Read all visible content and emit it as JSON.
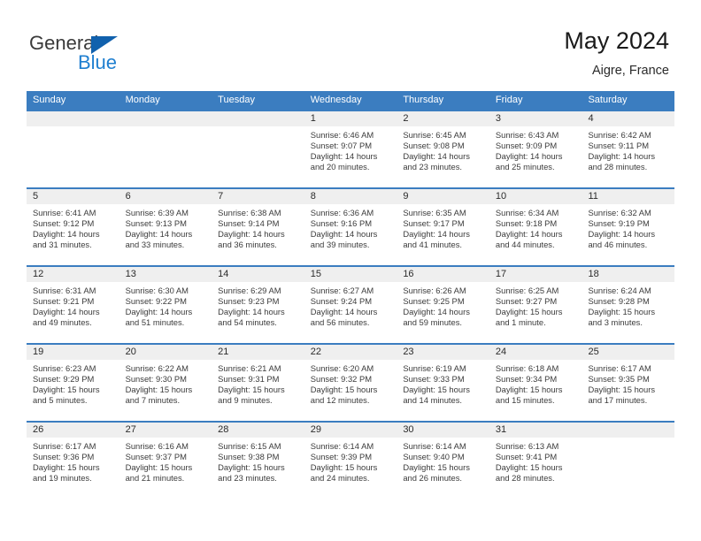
{
  "brand": {
    "name_part1": "General",
    "name_part2": "Blue",
    "triangle_color": "#1161ad",
    "blue_color": "#1f7fd0"
  },
  "header": {
    "title": "May 2024",
    "subtitle": "Aigre, France"
  },
  "theme": {
    "header_blue": "#3b7dc0",
    "day_number_band": "#efefef",
    "cell_background": "#ffffff",
    "text_color": "#3b3b3b"
  },
  "weekdays": [
    "Sunday",
    "Monday",
    "Tuesday",
    "Wednesday",
    "Thursday",
    "Friday",
    "Saturday"
  ],
  "weeks": [
    [
      {
        "day": "",
        "sunrise": "",
        "sunset": "",
        "daylight_line1": "",
        "daylight_line2": ""
      },
      {
        "day": "",
        "sunrise": "",
        "sunset": "",
        "daylight_line1": "",
        "daylight_line2": ""
      },
      {
        "day": "",
        "sunrise": "",
        "sunset": "",
        "daylight_line1": "",
        "daylight_line2": ""
      },
      {
        "day": "1",
        "sunrise": "Sunrise: 6:46 AM",
        "sunset": "Sunset: 9:07 PM",
        "daylight_line1": "Daylight: 14 hours",
        "daylight_line2": "and 20 minutes."
      },
      {
        "day": "2",
        "sunrise": "Sunrise: 6:45 AM",
        "sunset": "Sunset: 9:08 PM",
        "daylight_line1": "Daylight: 14 hours",
        "daylight_line2": "and 23 minutes."
      },
      {
        "day": "3",
        "sunrise": "Sunrise: 6:43 AM",
        "sunset": "Sunset: 9:09 PM",
        "daylight_line1": "Daylight: 14 hours",
        "daylight_line2": "and 25 minutes."
      },
      {
        "day": "4",
        "sunrise": "Sunrise: 6:42 AM",
        "sunset": "Sunset: 9:11 PM",
        "daylight_line1": "Daylight: 14 hours",
        "daylight_line2": "and 28 minutes."
      }
    ],
    [
      {
        "day": "5",
        "sunrise": "Sunrise: 6:41 AM",
        "sunset": "Sunset: 9:12 PM",
        "daylight_line1": "Daylight: 14 hours",
        "daylight_line2": "and 31 minutes."
      },
      {
        "day": "6",
        "sunrise": "Sunrise: 6:39 AM",
        "sunset": "Sunset: 9:13 PM",
        "daylight_line1": "Daylight: 14 hours",
        "daylight_line2": "and 33 minutes."
      },
      {
        "day": "7",
        "sunrise": "Sunrise: 6:38 AM",
        "sunset": "Sunset: 9:14 PM",
        "daylight_line1": "Daylight: 14 hours",
        "daylight_line2": "and 36 minutes."
      },
      {
        "day": "8",
        "sunrise": "Sunrise: 6:36 AM",
        "sunset": "Sunset: 9:16 PM",
        "daylight_line1": "Daylight: 14 hours",
        "daylight_line2": "and 39 minutes."
      },
      {
        "day": "9",
        "sunrise": "Sunrise: 6:35 AM",
        "sunset": "Sunset: 9:17 PM",
        "daylight_line1": "Daylight: 14 hours",
        "daylight_line2": "and 41 minutes."
      },
      {
        "day": "10",
        "sunrise": "Sunrise: 6:34 AM",
        "sunset": "Sunset: 9:18 PM",
        "daylight_line1": "Daylight: 14 hours",
        "daylight_line2": "and 44 minutes."
      },
      {
        "day": "11",
        "sunrise": "Sunrise: 6:32 AM",
        "sunset": "Sunset: 9:19 PM",
        "daylight_line1": "Daylight: 14 hours",
        "daylight_line2": "and 46 minutes."
      }
    ],
    [
      {
        "day": "12",
        "sunrise": "Sunrise: 6:31 AM",
        "sunset": "Sunset: 9:21 PM",
        "daylight_line1": "Daylight: 14 hours",
        "daylight_line2": "and 49 minutes."
      },
      {
        "day": "13",
        "sunrise": "Sunrise: 6:30 AM",
        "sunset": "Sunset: 9:22 PM",
        "daylight_line1": "Daylight: 14 hours",
        "daylight_line2": "and 51 minutes."
      },
      {
        "day": "14",
        "sunrise": "Sunrise: 6:29 AM",
        "sunset": "Sunset: 9:23 PM",
        "daylight_line1": "Daylight: 14 hours",
        "daylight_line2": "and 54 minutes."
      },
      {
        "day": "15",
        "sunrise": "Sunrise: 6:27 AM",
        "sunset": "Sunset: 9:24 PM",
        "daylight_line1": "Daylight: 14 hours",
        "daylight_line2": "and 56 minutes."
      },
      {
        "day": "16",
        "sunrise": "Sunrise: 6:26 AM",
        "sunset": "Sunset: 9:25 PM",
        "daylight_line1": "Daylight: 14 hours",
        "daylight_line2": "and 59 minutes."
      },
      {
        "day": "17",
        "sunrise": "Sunrise: 6:25 AM",
        "sunset": "Sunset: 9:27 PM",
        "daylight_line1": "Daylight: 15 hours",
        "daylight_line2": "and 1 minute."
      },
      {
        "day": "18",
        "sunrise": "Sunrise: 6:24 AM",
        "sunset": "Sunset: 9:28 PM",
        "daylight_line1": "Daylight: 15 hours",
        "daylight_line2": "and 3 minutes."
      }
    ],
    [
      {
        "day": "19",
        "sunrise": "Sunrise: 6:23 AM",
        "sunset": "Sunset: 9:29 PM",
        "daylight_line1": "Daylight: 15 hours",
        "daylight_line2": "and 5 minutes."
      },
      {
        "day": "20",
        "sunrise": "Sunrise: 6:22 AM",
        "sunset": "Sunset: 9:30 PM",
        "daylight_line1": "Daylight: 15 hours",
        "daylight_line2": "and 7 minutes."
      },
      {
        "day": "21",
        "sunrise": "Sunrise: 6:21 AM",
        "sunset": "Sunset: 9:31 PM",
        "daylight_line1": "Daylight: 15 hours",
        "daylight_line2": "and 9 minutes."
      },
      {
        "day": "22",
        "sunrise": "Sunrise: 6:20 AM",
        "sunset": "Sunset: 9:32 PM",
        "daylight_line1": "Daylight: 15 hours",
        "daylight_line2": "and 12 minutes."
      },
      {
        "day": "23",
        "sunrise": "Sunrise: 6:19 AM",
        "sunset": "Sunset: 9:33 PM",
        "daylight_line1": "Daylight: 15 hours",
        "daylight_line2": "and 14 minutes."
      },
      {
        "day": "24",
        "sunrise": "Sunrise: 6:18 AM",
        "sunset": "Sunset: 9:34 PM",
        "daylight_line1": "Daylight: 15 hours",
        "daylight_line2": "and 15 minutes."
      },
      {
        "day": "25",
        "sunrise": "Sunrise: 6:17 AM",
        "sunset": "Sunset: 9:35 PM",
        "daylight_line1": "Daylight: 15 hours",
        "daylight_line2": "and 17 minutes."
      }
    ],
    [
      {
        "day": "26",
        "sunrise": "Sunrise: 6:17 AM",
        "sunset": "Sunset: 9:36 PM",
        "daylight_line1": "Daylight: 15 hours",
        "daylight_line2": "and 19 minutes."
      },
      {
        "day": "27",
        "sunrise": "Sunrise: 6:16 AM",
        "sunset": "Sunset: 9:37 PM",
        "daylight_line1": "Daylight: 15 hours",
        "daylight_line2": "and 21 minutes."
      },
      {
        "day": "28",
        "sunrise": "Sunrise: 6:15 AM",
        "sunset": "Sunset: 9:38 PM",
        "daylight_line1": "Daylight: 15 hours",
        "daylight_line2": "and 23 minutes."
      },
      {
        "day": "29",
        "sunrise": "Sunrise: 6:14 AM",
        "sunset": "Sunset: 9:39 PM",
        "daylight_line1": "Daylight: 15 hours",
        "daylight_line2": "and 24 minutes."
      },
      {
        "day": "30",
        "sunrise": "Sunrise: 6:14 AM",
        "sunset": "Sunset: 9:40 PM",
        "daylight_line1": "Daylight: 15 hours",
        "daylight_line2": "and 26 minutes."
      },
      {
        "day": "31",
        "sunrise": "Sunrise: 6:13 AM",
        "sunset": "Sunset: 9:41 PM",
        "daylight_line1": "Daylight: 15 hours",
        "daylight_line2": "and 28 minutes."
      },
      {
        "day": "",
        "sunrise": "",
        "sunset": "",
        "daylight_line1": "",
        "daylight_line2": ""
      }
    ]
  ]
}
